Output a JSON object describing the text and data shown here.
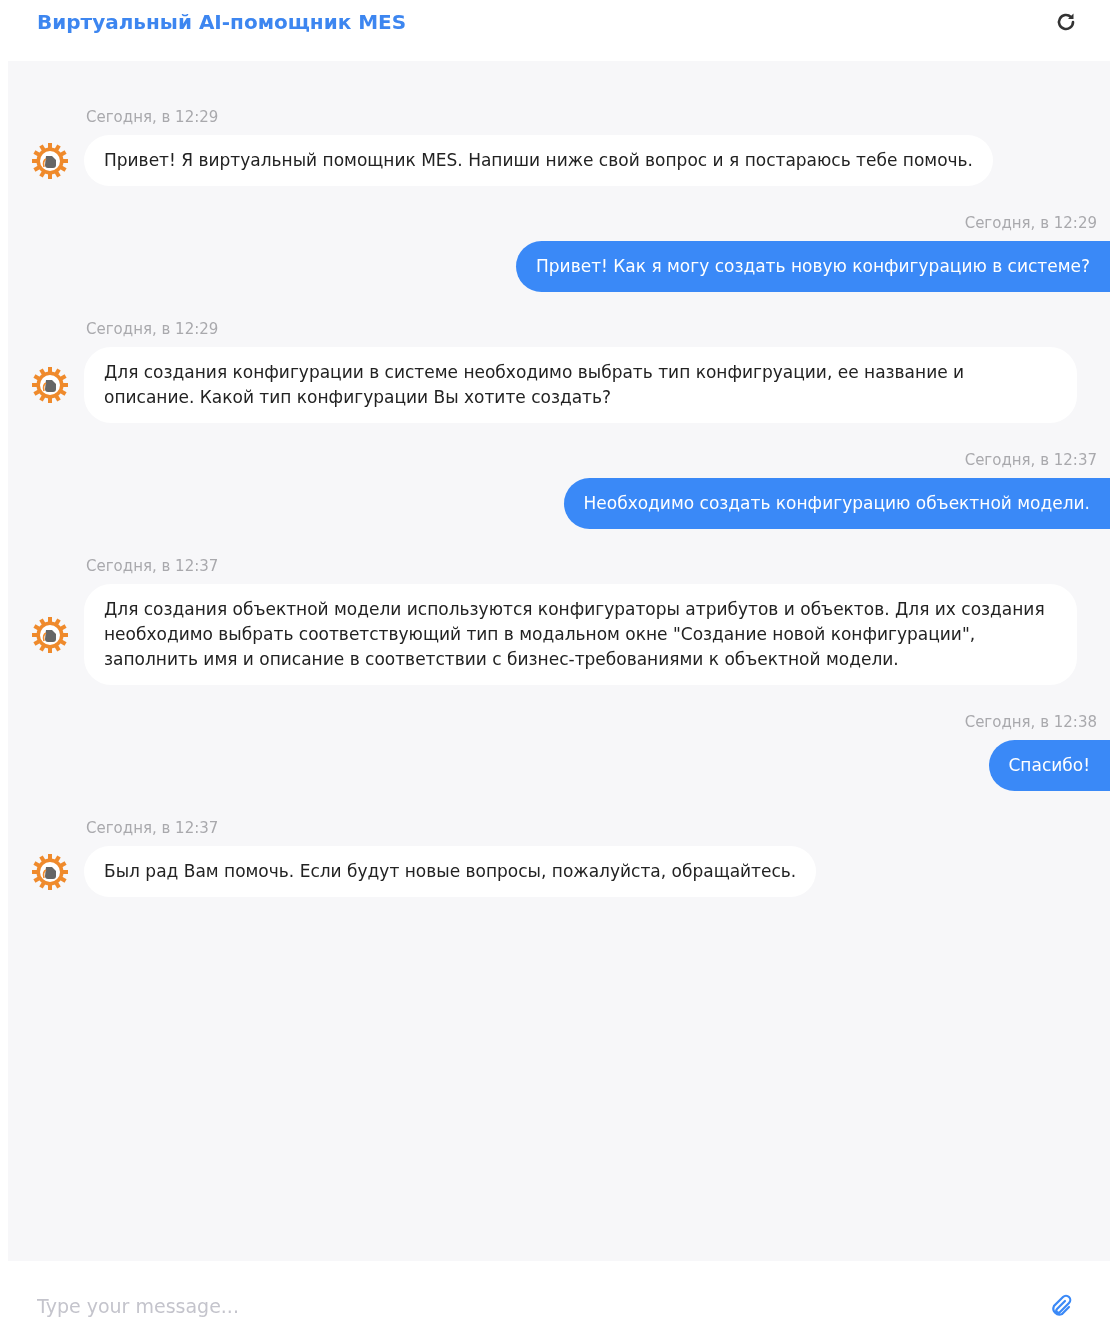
{
  "header": {
    "title": "Виртуальный AI-помощник MES"
  },
  "messages": [
    {
      "kind": "bot",
      "time": "Сегодня, в 12:29",
      "text": "Привет! Я виртуальный помощник MES. Напиши ниже свой вопрос и я постараюсь тебе помочь."
    },
    {
      "kind": "user",
      "time": "Сегодня, в 12:29",
      "text": "Привет! Как я могу создать новую конфигурацию в системе?"
    },
    {
      "kind": "bot",
      "time": "Сегодня, в 12:29",
      "text": "Для создания конфигурации в системе необходимо выбрать тип конфигруации, ее название и описание. Какой тип конфигурации Вы хотите создать?"
    },
    {
      "kind": "user",
      "time": "Сегодня, в 12:37",
      "text": "Необходимо создать конфигурацию объектной модели."
    },
    {
      "kind": "bot",
      "time": "Сегодня, в 12:37",
      "text": "Для создания объектной модели используются конфигураторы атрибутов и объектов. Для их создания необходимо выбрать соответствующий тип в модальном окне \"Создание новой конфигурации\", заполнить имя и описание в соответствии с бизнес-требованиями к объектной модели."
    },
    {
      "kind": "user",
      "time": "Сегодня, в 12:38",
      "text": "Спасибо!"
    },
    {
      "kind": "bot",
      "time": "Сегодня, в 12:37",
      "text": "Был рад Вам помочь. Если будут новые вопросы, пожалуйста, обращайтесь."
    }
  ],
  "composer": {
    "placeholder": "Type your message..."
  }
}
